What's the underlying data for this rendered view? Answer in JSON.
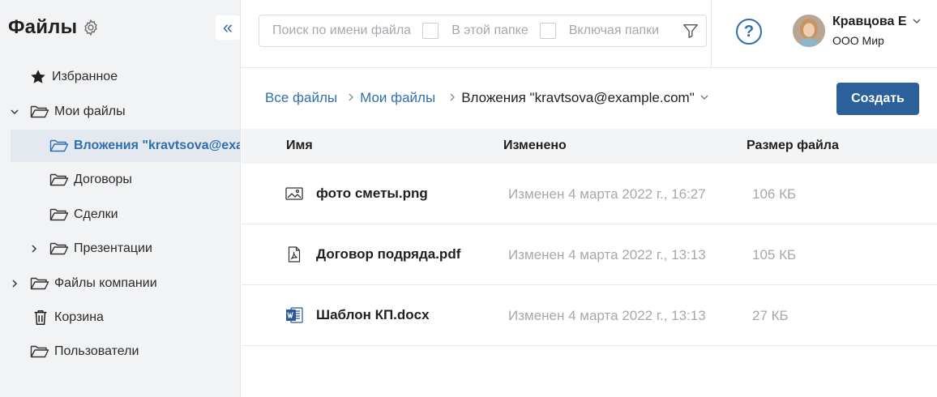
{
  "sidebar": {
    "title": "Файлы",
    "collapse_glyph": "«",
    "items": [
      {
        "label": "Избранное",
        "icon": "star-icon"
      },
      {
        "label": "Мои файлы",
        "icon": "folder-icon"
      },
      {
        "label": "Вложения \"kravtsova@example.com\"",
        "icon": "folder-icon"
      },
      {
        "label": "Договоры",
        "icon": "folder-icon"
      },
      {
        "label": "Сделки",
        "icon": "folder-icon"
      },
      {
        "label": "Презентации",
        "icon": "folder-icon"
      },
      {
        "label": "Файлы компании",
        "icon": "folder-icon"
      },
      {
        "label": "Корзина",
        "icon": "trash-icon"
      },
      {
        "label": "Пользователи",
        "icon": "folder-icon"
      }
    ]
  },
  "search": {
    "placeholder": "Поиск по имени файла",
    "in_folder_label": "В этой папке",
    "include_folders_label": "Включая папки"
  },
  "help_glyph": "?",
  "user": {
    "name": "Кравцова Е",
    "org": "ООО Мир"
  },
  "breadcrumbs": {
    "all_files": "Все файлы",
    "my_files": "Мои файлы",
    "current": "Вложения \"kravtsova@example.com\""
  },
  "create_button": "Создать",
  "table": {
    "headers": [
      "Имя",
      "Изменено",
      "Размер файла"
    ],
    "rows": [
      {
        "name": "фото сметы.png",
        "modified": "Изменен 4 марта 2022 г., 16:27",
        "size": "106 КБ",
        "icon": "image-file-icon"
      },
      {
        "name": "Договор подряда.pdf",
        "modified": "Изменен 4 марта 2022 г., 13:13",
        "size": "105 КБ",
        "icon": "pdf-file-icon"
      },
      {
        "name": "Шаблон КП.docx",
        "modified": "Изменен 4 марта 2022 г., 13:13",
        "size": "27 КБ",
        "icon": "word-file-icon"
      }
    ]
  },
  "colors": {
    "accent": "#2f6fb0",
    "button": "#2b609b",
    "sidebar_bg": "#f2f3f5",
    "selected_bg": "#e4e9f0",
    "muted_text": "#a4a9ae"
  }
}
